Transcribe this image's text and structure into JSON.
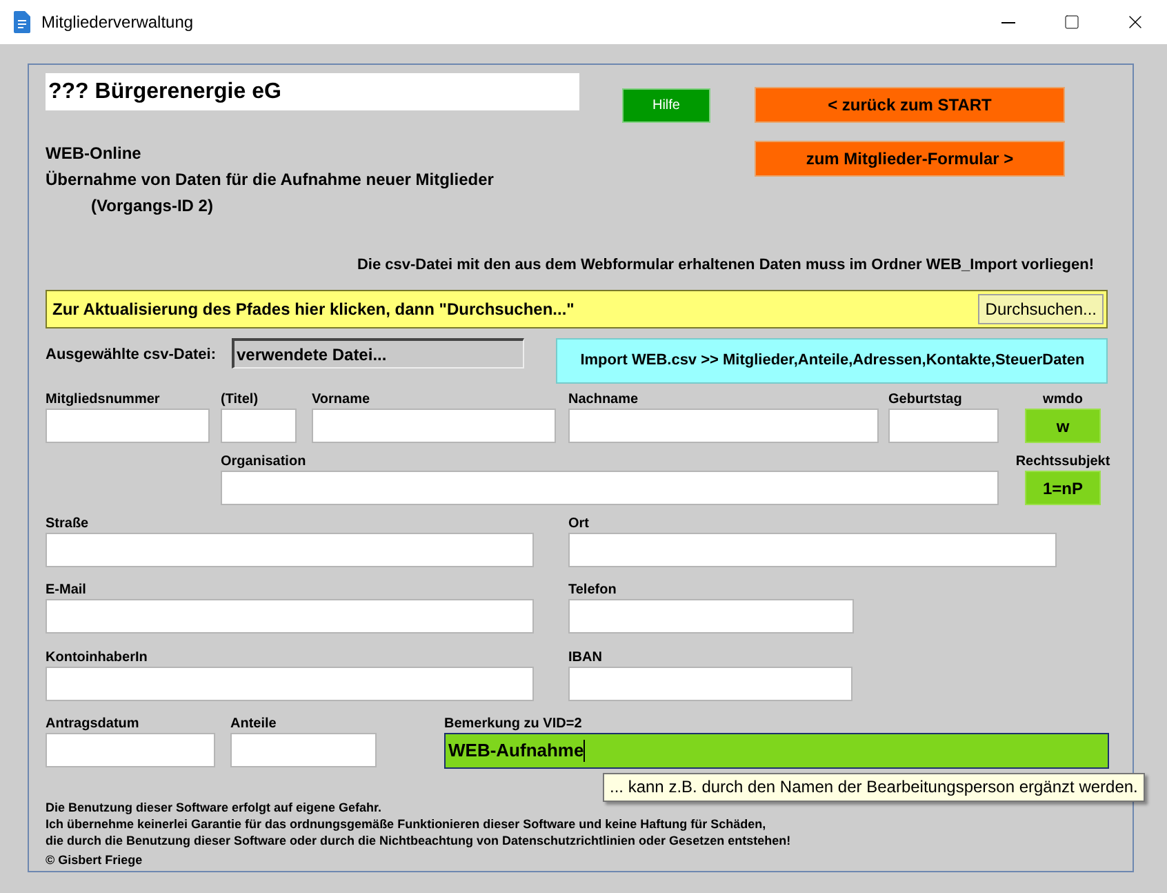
{
  "window": {
    "title": "Mitgliederverwaltung"
  },
  "header": {
    "org_name": "??? Bürgerenergie eG",
    "help_button": "Hilfe",
    "nav_buttons": [
      "< zurück zum START",
      "zum Mitglieder-Formular  >"
    ],
    "subtitle_lines": [
      "WEB-Online",
      "Übernahme von Daten für die Aufnahme neuer Mitglieder",
      "(Vorgangs-ID 2)"
    ]
  },
  "notice": "Die csv-Datei mit den aus dem Webformular erhaltenen Daten muss im Ordner WEB_Import vorliegen!",
  "path_bar": {
    "text": "Zur Aktualisierung des Pfades hier klicken, dann \"Durchsuchen...\"",
    "browse_button": "Durchsuchen..."
  },
  "csv_file": {
    "label": "Ausgewählte csv-Datei:",
    "value": "verwendete Datei..."
  },
  "import_button": "Import WEB.csv >> Mitglieder,Anteile,Adressen,Kontakte,SteuerDaten",
  "rows": [
    [
      {
        "kind": "text",
        "label": "Mitgliedsnummer"
      },
      {
        "kind": "text",
        "label": "(Titel)"
      },
      {
        "kind": "text",
        "label": "Vorname"
      },
      {
        "kind": "text",
        "label": "Nachname"
      },
      {
        "kind": "text",
        "label": "Geburtstag"
      },
      {
        "kind": "choice",
        "label": "wmdo",
        "value": "w"
      }
    ],
    [
      {
        "kind": "text",
        "label": "Organisation"
      },
      {
        "kind": "choice",
        "label": "Rechtssubjekt",
        "value": "1=nP"
      }
    ],
    [
      {
        "kind": "text",
        "label": "Straße"
      },
      {
        "kind": "text",
        "label": "Ort"
      }
    ],
    [
      {
        "kind": "text",
        "label": "E-Mail"
      },
      {
        "kind": "text",
        "label": "Telefon"
      }
    ],
    [
      {
        "kind": "text",
        "label": "KontoinhaberIn"
      },
      {
        "kind": "text",
        "label": "IBAN"
      }
    ],
    [
      {
        "kind": "text",
        "label": "Antragsdatum"
      },
      {
        "kind": "text",
        "label": "Anteile"
      },
      {
        "kind": "remark",
        "label": "Bemerkung zu VID=2",
        "value": "WEB-Aufnahme",
        "tooltip": "... kann z.B. durch den Namen der Bearbeitungsperson ergänzt werden."
      }
    ]
  ],
  "footer": [
    "Die Benutzung dieser Software erfolgt auf eigene Gefahr.",
    "Ich übernehme keinerlei Garantie für das ordnungsgemäße Funktionieren dieser Software und keine Haftung für Schäden,",
    "die durch die Benutzung dieser Software oder durch die Nichtbeachtung von Datenschutzrichtlinien oder Gesetzen entstehen!",
    "© Gisbert Friege"
  ]
}
